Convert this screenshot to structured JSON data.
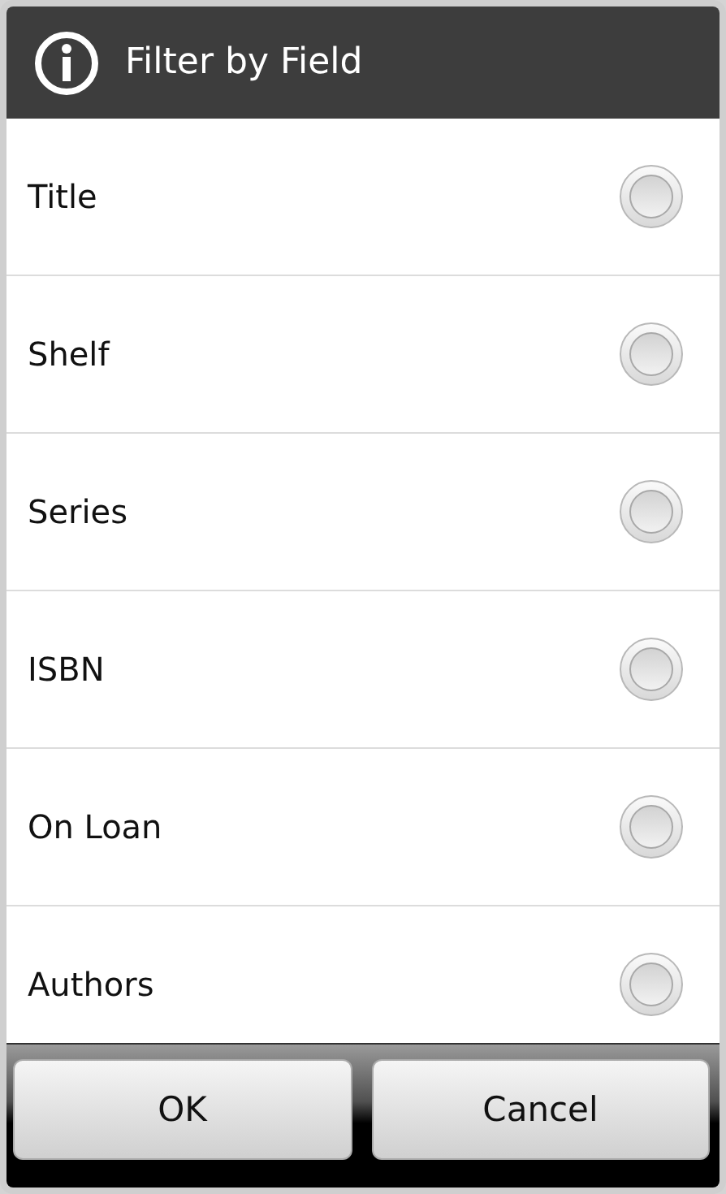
{
  "dialog": {
    "title": "Filter by Field"
  },
  "options": [
    {
      "label": "Title",
      "selected": false
    },
    {
      "label": "Shelf",
      "selected": false
    },
    {
      "label": "Series",
      "selected": false
    },
    {
      "label": "ISBN",
      "selected": false
    },
    {
      "label": "On Loan",
      "selected": false
    },
    {
      "label": "Authors",
      "selected": false
    }
  ],
  "buttons": [
    "OK",
    "Cancel"
  ]
}
